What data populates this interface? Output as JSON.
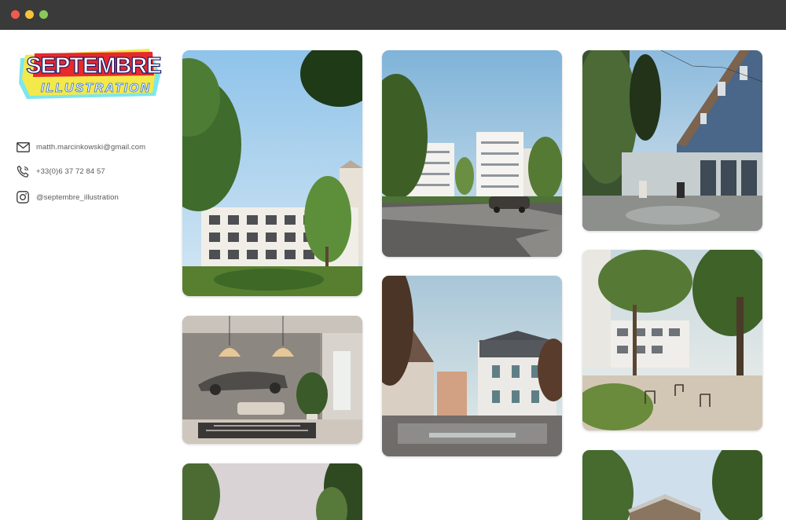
{
  "window": {
    "controls": [
      "close",
      "minimize",
      "maximize"
    ],
    "control_colors": [
      "#ef5b4f",
      "#f5c33b",
      "#89c95a"
    ]
  },
  "brand": {
    "logo_line1": "SEPTEMBRE",
    "logo_line2": "ILLUSTRATION",
    "colors": {
      "red": "#e8282b",
      "yellow": "#f3e94a",
      "cyan": "#7ee6ee"
    }
  },
  "contact": {
    "email": {
      "icon": "mail-icon",
      "text": "matth.marcinkowski@gmail.com"
    },
    "phone": {
      "icon": "phone-icon",
      "text": "+33(0)6 37 72 84 57"
    },
    "instagram": {
      "icon": "instagram-icon",
      "text": "@septembre_illustration"
    }
  },
  "gallery": {
    "items": [
      {
        "name": "residential-courtyard-trees",
        "column": 1
      },
      {
        "name": "living-room-interior-car",
        "column": 1
      },
      {
        "name": "tree-lined-path",
        "column": 1
      },
      {
        "name": "white-apartment-blocks-street",
        "column": 2
      },
      {
        "name": "wet-plaza-old-houses",
        "column": 2
      },
      {
        "name": "blue-building-terrace",
        "column": 3
      },
      {
        "name": "garden-courtyard-chairs",
        "column": 3
      },
      {
        "name": "wooden-house-trees",
        "column": 3
      }
    ]
  }
}
